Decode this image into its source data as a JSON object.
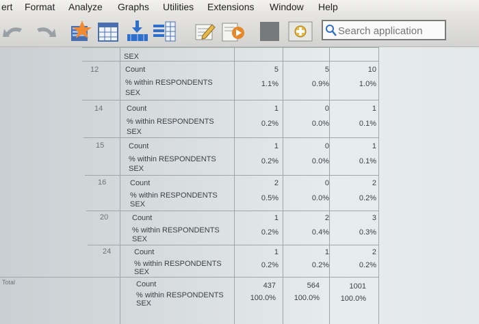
{
  "menu": {
    "items": [
      "ert",
      "Format",
      "Analyze",
      "Graphs",
      "Utilities",
      "Extensions",
      "Window",
      "Help"
    ]
  },
  "toolbar": {
    "icons": [
      "undo-icon",
      "redo-icon",
      "star-chart-icon",
      "cases-icon",
      "split-file-icon",
      "value-labels-icon",
      "edit-icon",
      "script-icon",
      "square-icon",
      "add-icon"
    ]
  },
  "search": {
    "placeholder": "Search application"
  },
  "table": {
    "top_label": "SEX",
    "stat_count": "Count",
    "stat_pct_line1": "% within RESPONDENTS",
    "stat_pct_line2": "SEX",
    "total_label": "Total",
    "rows": [
      {
        "label": "12",
        "count": [
          "5",
          "5",
          "10"
        ],
        "pct": [
          "1.1%",
          "0.9%",
          "1.0%"
        ]
      },
      {
        "label": "14",
        "count": [
          "1",
          "0",
          "1"
        ],
        "pct": [
          "0.2%",
          "0.0%",
          "0.1%"
        ]
      },
      {
        "label": "15",
        "count": [
          "1",
          "0",
          "1"
        ],
        "pct": [
          "0.2%",
          "0.0%",
          "0.1%"
        ]
      },
      {
        "label": "16",
        "count": [
          "2",
          "0",
          "2"
        ],
        "pct": [
          "0.5%",
          "0.0%",
          "0.2%"
        ]
      },
      {
        "label": "20",
        "count": [
          "1",
          "2",
          "3"
        ],
        "pct": [
          "0.2%",
          "0.4%",
          "0.3%"
        ]
      },
      {
        "label": "24",
        "count": [
          "1",
          "1",
          "2"
        ],
        "pct": [
          "0.2%",
          "0.2%",
          "0.2%"
        ]
      },
      {
        "label": "",
        "count": [
          "437",
          "564",
          "1001"
        ],
        "pct": [
          "100.0%",
          "100.0%",
          "100.0%"
        ]
      }
    ]
  }
}
